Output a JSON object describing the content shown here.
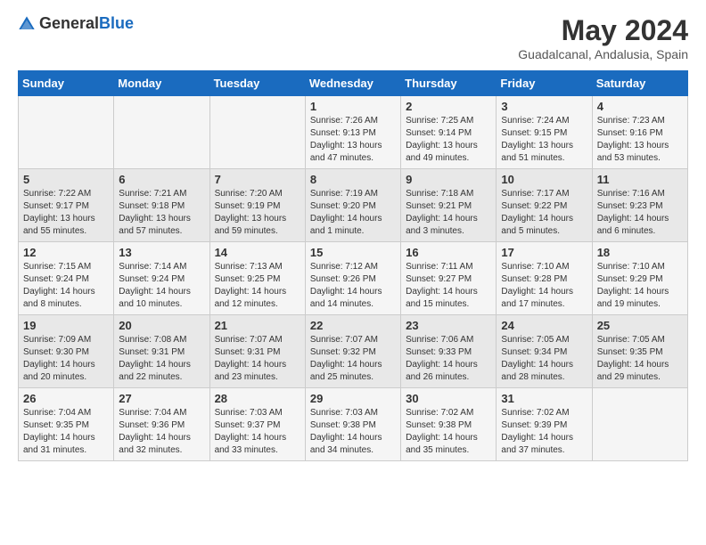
{
  "header": {
    "logo_general": "General",
    "logo_blue": "Blue",
    "month_title": "May 2024",
    "location": "Guadalcanal, Andalusia, Spain"
  },
  "days_of_week": [
    "Sunday",
    "Monday",
    "Tuesday",
    "Wednesday",
    "Thursday",
    "Friday",
    "Saturday"
  ],
  "weeks": [
    [
      {
        "day": "",
        "info": ""
      },
      {
        "day": "",
        "info": ""
      },
      {
        "day": "",
        "info": ""
      },
      {
        "day": "1",
        "info": "Sunrise: 7:26 AM\nSunset: 9:13 PM\nDaylight: 13 hours\nand 47 minutes."
      },
      {
        "day": "2",
        "info": "Sunrise: 7:25 AM\nSunset: 9:14 PM\nDaylight: 13 hours\nand 49 minutes."
      },
      {
        "day": "3",
        "info": "Sunrise: 7:24 AM\nSunset: 9:15 PM\nDaylight: 13 hours\nand 51 minutes."
      },
      {
        "day": "4",
        "info": "Sunrise: 7:23 AM\nSunset: 9:16 PM\nDaylight: 13 hours\nand 53 minutes."
      }
    ],
    [
      {
        "day": "5",
        "info": "Sunrise: 7:22 AM\nSunset: 9:17 PM\nDaylight: 13 hours\nand 55 minutes."
      },
      {
        "day": "6",
        "info": "Sunrise: 7:21 AM\nSunset: 9:18 PM\nDaylight: 13 hours\nand 57 minutes."
      },
      {
        "day": "7",
        "info": "Sunrise: 7:20 AM\nSunset: 9:19 PM\nDaylight: 13 hours\nand 59 minutes."
      },
      {
        "day": "8",
        "info": "Sunrise: 7:19 AM\nSunset: 9:20 PM\nDaylight: 14 hours\nand 1 minute."
      },
      {
        "day": "9",
        "info": "Sunrise: 7:18 AM\nSunset: 9:21 PM\nDaylight: 14 hours\nand 3 minutes."
      },
      {
        "day": "10",
        "info": "Sunrise: 7:17 AM\nSunset: 9:22 PM\nDaylight: 14 hours\nand 5 minutes."
      },
      {
        "day": "11",
        "info": "Sunrise: 7:16 AM\nSunset: 9:23 PM\nDaylight: 14 hours\nand 6 minutes."
      }
    ],
    [
      {
        "day": "12",
        "info": "Sunrise: 7:15 AM\nSunset: 9:24 PM\nDaylight: 14 hours\nand 8 minutes."
      },
      {
        "day": "13",
        "info": "Sunrise: 7:14 AM\nSunset: 9:24 PM\nDaylight: 14 hours\nand 10 minutes."
      },
      {
        "day": "14",
        "info": "Sunrise: 7:13 AM\nSunset: 9:25 PM\nDaylight: 14 hours\nand 12 minutes."
      },
      {
        "day": "15",
        "info": "Sunrise: 7:12 AM\nSunset: 9:26 PM\nDaylight: 14 hours\nand 14 minutes."
      },
      {
        "day": "16",
        "info": "Sunrise: 7:11 AM\nSunset: 9:27 PM\nDaylight: 14 hours\nand 15 minutes."
      },
      {
        "day": "17",
        "info": "Sunrise: 7:10 AM\nSunset: 9:28 PM\nDaylight: 14 hours\nand 17 minutes."
      },
      {
        "day": "18",
        "info": "Sunrise: 7:10 AM\nSunset: 9:29 PM\nDaylight: 14 hours\nand 19 minutes."
      }
    ],
    [
      {
        "day": "19",
        "info": "Sunrise: 7:09 AM\nSunset: 9:30 PM\nDaylight: 14 hours\nand 20 minutes."
      },
      {
        "day": "20",
        "info": "Sunrise: 7:08 AM\nSunset: 9:31 PM\nDaylight: 14 hours\nand 22 minutes."
      },
      {
        "day": "21",
        "info": "Sunrise: 7:07 AM\nSunset: 9:31 PM\nDaylight: 14 hours\nand 23 minutes."
      },
      {
        "day": "22",
        "info": "Sunrise: 7:07 AM\nSunset: 9:32 PM\nDaylight: 14 hours\nand 25 minutes."
      },
      {
        "day": "23",
        "info": "Sunrise: 7:06 AM\nSunset: 9:33 PM\nDaylight: 14 hours\nand 26 minutes."
      },
      {
        "day": "24",
        "info": "Sunrise: 7:05 AM\nSunset: 9:34 PM\nDaylight: 14 hours\nand 28 minutes."
      },
      {
        "day": "25",
        "info": "Sunrise: 7:05 AM\nSunset: 9:35 PM\nDaylight: 14 hours\nand 29 minutes."
      }
    ],
    [
      {
        "day": "26",
        "info": "Sunrise: 7:04 AM\nSunset: 9:35 PM\nDaylight: 14 hours\nand 31 minutes."
      },
      {
        "day": "27",
        "info": "Sunrise: 7:04 AM\nSunset: 9:36 PM\nDaylight: 14 hours\nand 32 minutes."
      },
      {
        "day": "28",
        "info": "Sunrise: 7:03 AM\nSunset: 9:37 PM\nDaylight: 14 hours\nand 33 minutes."
      },
      {
        "day": "29",
        "info": "Sunrise: 7:03 AM\nSunset: 9:38 PM\nDaylight: 14 hours\nand 34 minutes."
      },
      {
        "day": "30",
        "info": "Sunrise: 7:02 AM\nSunset: 9:38 PM\nDaylight: 14 hours\nand 35 minutes."
      },
      {
        "day": "31",
        "info": "Sunrise: 7:02 AM\nSunset: 9:39 PM\nDaylight: 14 hours\nand 37 minutes."
      },
      {
        "day": "",
        "info": ""
      }
    ]
  ]
}
